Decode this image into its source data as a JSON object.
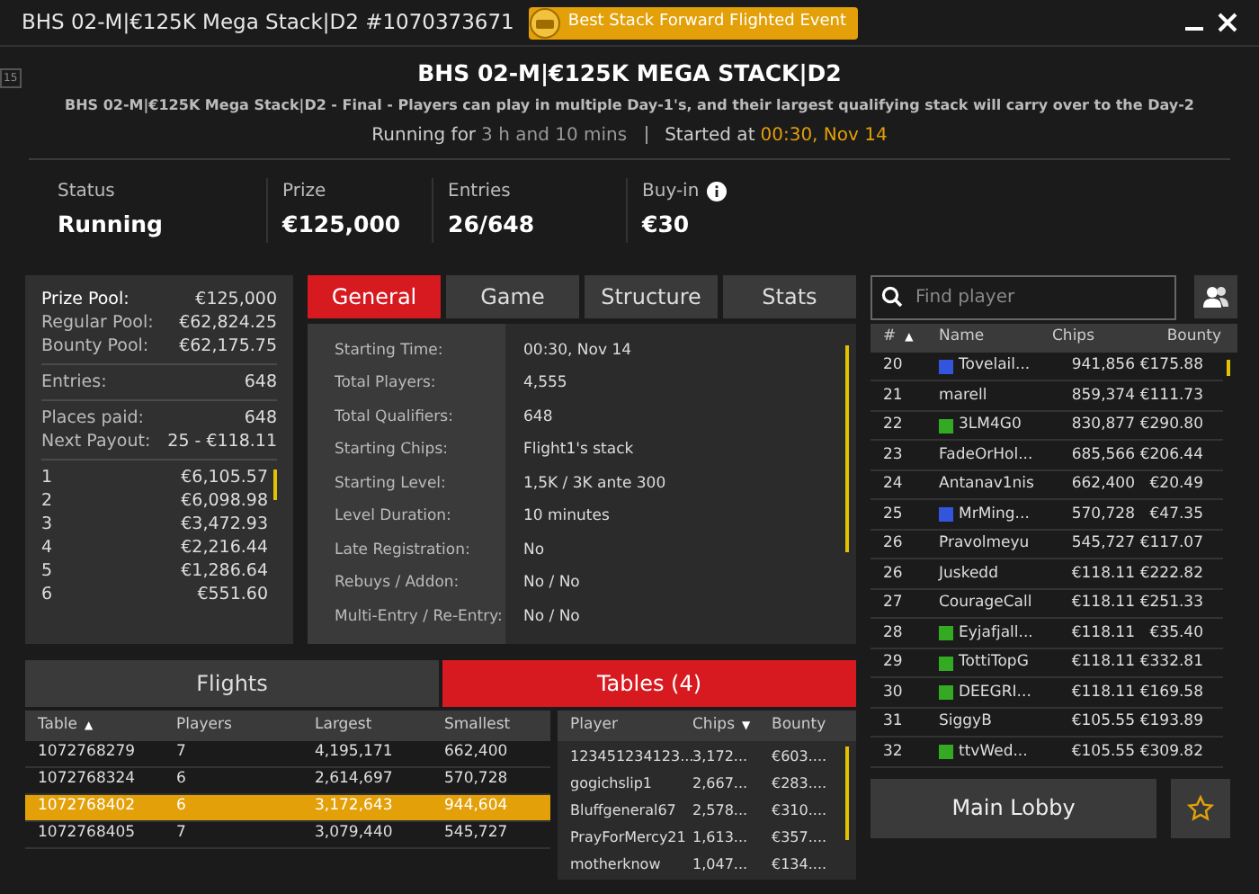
{
  "window": {
    "title": "BHS 02-M|€125K Mega Stack|D2 #1070373671",
    "badge": "Best Stack Forward Flighted Event",
    "side_label": "15"
  },
  "header": {
    "title": "BHS 02-M|€125K MEGA STACK|D2",
    "description": "BHS 02-M|€125K Mega Stack|D2 - Final - Players can play in multiple Day-1's, and their largest qualifying stack will carry over to the Day-2",
    "running_label": "Running for",
    "running_value": "3 h and 10 mins",
    "started_label": "Started at",
    "started_value": "00:30, Nov 14"
  },
  "stats": [
    {
      "label": "Status",
      "value": "Running",
      "info": false
    },
    {
      "label": "Prize",
      "value": "€125,000",
      "info": false
    },
    {
      "label": "Entries",
      "value": "26/648",
      "info": false
    },
    {
      "label": "Buy-in",
      "value": "€30",
      "info": true
    }
  ],
  "prize_summary": {
    "groups": [
      [
        {
          "label": "Prize Pool:",
          "value": "€125,000",
          "strong": true
        },
        {
          "label": "Regular Pool:",
          "value": "€62,824.25",
          "strong": false
        },
        {
          "label": "Bounty Pool:",
          "value": "€62,175.75",
          "strong": false
        }
      ],
      [
        {
          "label": "Entries:",
          "value": "648",
          "strong": false
        }
      ],
      [
        {
          "label": "Places paid:",
          "value": "648",
          "strong": false
        },
        {
          "label": "Next Payout:",
          "value": "25 - €118.11",
          "strong": false
        }
      ]
    ],
    "payouts": [
      {
        "place": "1",
        "amount": "€6,105.57"
      },
      {
        "place": "2",
        "amount": "€6,098.98"
      },
      {
        "place": "3",
        "amount": "€3,472.93"
      },
      {
        "place": "4",
        "amount": "€2,216.44"
      },
      {
        "place": "5",
        "amount": "€1,286.64"
      },
      {
        "place": "6",
        "amount": "€551.60"
      }
    ]
  },
  "info_tabs": [
    {
      "label": "General",
      "selected": true
    },
    {
      "label": "Game",
      "selected": false
    },
    {
      "label": "Structure",
      "selected": false
    },
    {
      "label": "Stats",
      "selected": false
    }
  ],
  "general": [
    {
      "label": "Starting Time:",
      "value": "00:30, Nov 14"
    },
    {
      "label": "Total Players:",
      "value": "4,555"
    },
    {
      "label": "Total Qualifiers:",
      "value": "648"
    },
    {
      "label": "Starting Chips:",
      "value": "Flight1's stack"
    },
    {
      "label": "Starting Level:",
      "value": "1,5K / 3K ante 300"
    },
    {
      "label": "Level Duration:",
      "value": "10 minutes"
    },
    {
      "label": "Late Registration:",
      "value": "No"
    },
    {
      "label": "Rebuys / Addon:",
      "value": "No / No"
    },
    {
      "label": "Multi-Entry / Re-Entry:",
      "value": "No / No"
    }
  ],
  "bottom_tabs": [
    {
      "label": "Flights",
      "selected": false
    },
    {
      "label": "Tables (4)",
      "selected": true
    }
  ],
  "tables": {
    "columns": [
      "Table",
      "Players",
      "Largest",
      "Smallest"
    ],
    "sort_marker": "▲",
    "rows": [
      {
        "cells": [
          "1072768279",
          "7",
          "4,195,171",
          "662,400"
        ],
        "selected": false
      },
      {
        "cells": [
          "1072768324",
          "6",
          "2,614,697",
          "570,728"
        ],
        "selected": false
      },
      {
        "cells": [
          "1072768402",
          "6",
          "3,172,643",
          "944,604"
        ],
        "selected": true
      },
      {
        "cells": [
          "1072768405",
          "7",
          "3,079,440",
          "545,727"
        ],
        "selected": false
      }
    ]
  },
  "table_players": {
    "columns": [
      "Player",
      "Chips",
      "Bounty"
    ],
    "sort_marker": "▼",
    "rows": [
      [
        "123451234123...",
        "3,172...",
        "€603...."
      ],
      [
        "gogichslip1",
        "2,667...",
        "€283...."
      ],
      [
        "Bluffgeneral67",
        "2,578...",
        "€310...."
      ],
      [
        "PrayForMercy21",
        "1,613...",
        "€357...."
      ],
      [
        "motherknow",
        "1,047...",
        "€134...."
      ]
    ]
  },
  "search": {
    "placeholder": "Find player"
  },
  "players": {
    "columns": [
      "#",
      "Name",
      "Chips",
      "Bounty"
    ],
    "sort_marker": "▲",
    "rows": [
      {
        "rank": "20",
        "name": "Tovelail...",
        "chips": "941,856",
        "bounty": "€175.88",
        "color": "#3355dd"
      },
      {
        "rank": "21",
        "name": "marell",
        "chips": "859,374",
        "bounty": "€111.73"
      },
      {
        "rank": "22",
        "name": "3LM4G0",
        "chips": "830,877",
        "bounty": "€290.80",
        "color": "#33aa22"
      },
      {
        "rank": "23",
        "name": "FadeOrHol...",
        "chips": "685,566",
        "bounty": "€206.44"
      },
      {
        "rank": "24",
        "name": "Antanav1nis",
        "chips": "662,400",
        "bounty": "€20.49"
      },
      {
        "rank": "25",
        "name": "MrMing...",
        "chips": "570,728",
        "bounty": "€47.35",
        "color": "#3355dd"
      },
      {
        "rank": "26",
        "name": "Pravolmeyu",
        "chips": "545,727",
        "bounty": "€117.07"
      },
      {
        "rank": "26",
        "name": "Juskedd",
        "chips": "€118.11",
        "bounty": "€222.82"
      },
      {
        "rank": "27",
        "name": "CourageCall",
        "chips": "€118.11",
        "bounty": "€251.33"
      },
      {
        "rank": "28",
        "name": "Eyjafjall...",
        "chips": "€118.11",
        "bounty": "€35.40",
        "color": "#33aa22"
      },
      {
        "rank": "29",
        "name": "TottiTopG",
        "chips": "€118.11",
        "bounty": "€332.81",
        "color": "#33aa22"
      },
      {
        "rank": "30",
        "name": "DEEGRI...",
        "chips": "€118.11",
        "bounty": "€169.58",
        "color": "#33aa22"
      },
      {
        "rank": "31",
        "name": "SiggyB",
        "chips": "€105.55",
        "bounty": "€193.89"
      },
      {
        "rank": "32",
        "name": "ttvWed...",
        "chips": "€105.55",
        "bounty": "€309.82",
        "color": "#33aa22"
      }
    ]
  },
  "main_lobby": "Main Lobby"
}
